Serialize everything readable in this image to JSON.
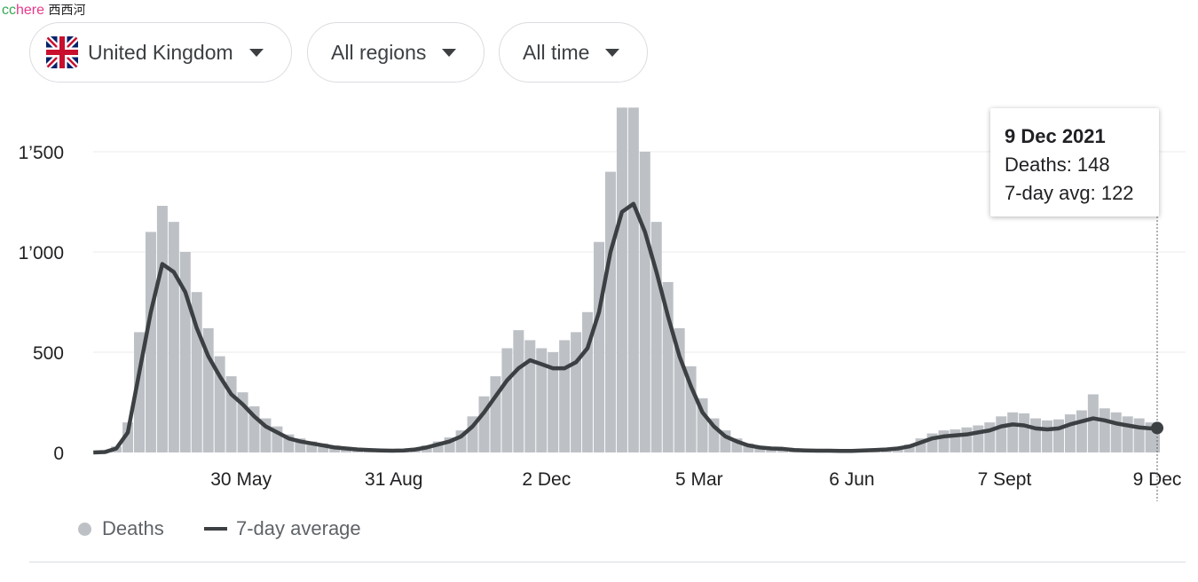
{
  "watermark": {
    "a": "cc",
    "b": "here",
    "c": "西西河"
  },
  "filters": [
    {
      "label": "United Kingdom",
      "icon": "uk-flag-icon"
    },
    {
      "label": "All regions"
    },
    {
      "label": "All time"
    }
  ],
  "tooltip": {
    "date": "9 Dec 2021",
    "deaths": "Deaths: 148",
    "avg": "7-day avg: 122"
  },
  "legend": {
    "deaths": "Deaths",
    "avg": "7-day average"
  },
  "colors": {
    "bars": "#bdc1c6",
    "line": "#3c4043",
    "grid": "#ebebeb"
  },
  "chart_data": {
    "type": "bar+line",
    "ylim": [
      0,
      1720
    ],
    "yticks": [
      {
        "v": 0,
        "label": "0"
      },
      {
        "v": 500,
        "label": "500"
      },
      {
        "v": 1000,
        "label": "1’000"
      },
      {
        "v": 1500,
        "label": "1’500"
      }
    ],
    "xticks": [
      {
        "d": "2020-05-30",
        "label": "30 May"
      },
      {
        "d": "2020-08-31",
        "label": "31 Aug"
      },
      {
        "d": "2020-12-02",
        "label": "2 Dec"
      },
      {
        "d": "2021-03-05",
        "label": "5 Mar"
      },
      {
        "d": "2021-06-06",
        "label": "6 Jun"
      },
      {
        "d": "2021-09-07",
        "label": "7 Sept"
      },
      {
        "d": "2021-12-09",
        "label": "9 Dec"
      }
    ],
    "grid": true,
    "legend_position": "bottom-left",
    "start": "2020-03-01",
    "step_days": 7,
    "avg": [
      0,
      2,
      20,
      100,
      400,
      700,
      940,
      900,
      800,
      620,
      480,
      380,
      290,
      240,
      180,
      130,
      100,
      70,
      55,
      45,
      35,
      25,
      20,
      15,
      12,
      10,
      9,
      10,
      15,
      25,
      40,
      55,
      80,
      130,
      200,
      280,
      360,
      420,
      460,
      440,
      420,
      420,
      450,
      520,
      700,
      1000,
      1200,
      1240,
      1100,
      900,
      680,
      480,
      330,
      200,
      130,
      80,
      55,
      35,
      25,
      20,
      18,
      12,
      10,
      9,
      9,
      8,
      8,
      10,
      12,
      15,
      20,
      30,
      50,
      70,
      80,
      85,
      90,
      100,
      110,
      130,
      140,
      135,
      120,
      115,
      120,
      140,
      155,
      170,
      160,
      145,
      135,
      125,
      120
    ],
    "deaths": [
      0,
      3,
      30,
      150,
      600,
      1100,
      1230,
      1150,
      1000,
      800,
      620,
      480,
      380,
      300,
      230,
      170,
      130,
      90,
      70,
      55,
      45,
      35,
      28,
      20,
      16,
      14,
      12,
      14,
      20,
      35,
      55,
      75,
      110,
      180,
      280,
      380,
      520,
      610,
      560,
      520,
      500,
      560,
      600,
      700,
      1050,
      1400,
      1720,
      1720,
      1500,
      1150,
      850,
      620,
      430,
      270,
      170,
      110,
      70,
      45,
      33,
      26,
      22,
      16,
      13,
      12,
      12,
      10,
      11,
      13,
      16,
      20,
      27,
      40,
      70,
      95,
      110,
      115,
      125,
      135,
      150,
      180,
      200,
      195,
      170,
      160,
      165,
      190,
      210,
      290,
      220,
      200,
      180,
      170,
      150
    ],
    "last": {
      "d": "2021-12-09",
      "deaths": 148,
      "avg": 122
    }
  }
}
